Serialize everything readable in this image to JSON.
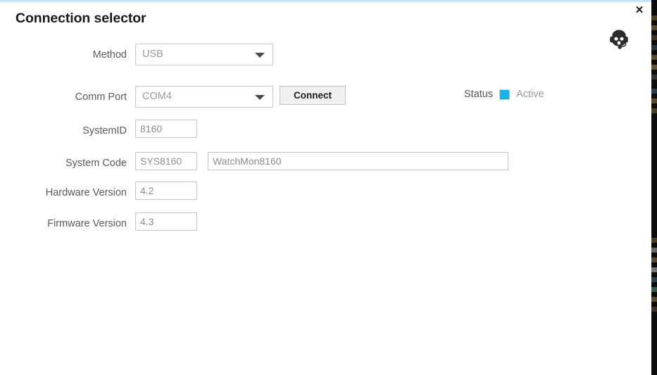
{
  "dialog": {
    "title": "Connection selector",
    "close_label": "✕",
    "agent_icon": "headset-support-avatar-icon",
    "accent_color": "#bfe6f7"
  },
  "form": {
    "rows": [
      {
        "label": "Method",
        "value": "USB",
        "control": "combobox"
      },
      {
        "label": "Comm Port",
        "value": "COM4",
        "control": "combobox"
      },
      {
        "label": "SystemID",
        "value": "8160",
        "control": "textbox"
      },
      {
        "label": "System Code",
        "value": "SYS8160",
        "control": "textbox"
      },
      {
        "label": "Hardware Version",
        "value": "4.2",
        "control": "textbox"
      },
      {
        "label": "Firmware Version",
        "value": "4.3",
        "control": "textbox"
      }
    ],
    "system_name": "WatchMon8160"
  },
  "actions": {
    "connect_label": "Connect"
  },
  "status": {
    "label": "Status",
    "state": "Active",
    "indicator_color": "#17b3e8",
    "checked": true
  }
}
